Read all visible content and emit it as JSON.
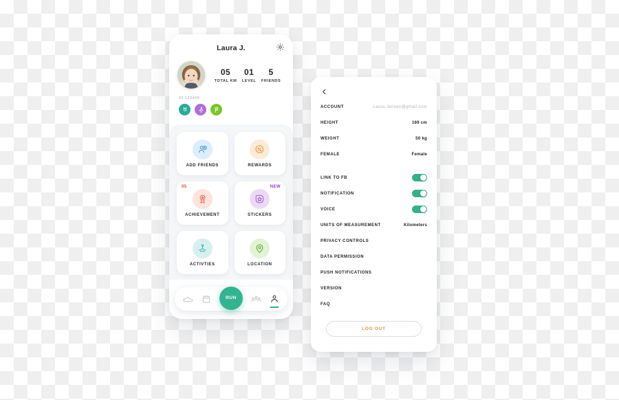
{
  "colors": {
    "green": "#34b392",
    "toggle_on": "#36b08c",
    "orange": "#f0912f",
    "red": "#e8432b",
    "purple": "#8b3fd4",
    "text_dark": "#1d1e24",
    "muted": "#b3b6bd",
    "grid_bg": "#f4f6f8"
  },
  "profile": {
    "name": "Laura J.",
    "settings_icon": "gear-icon",
    "avatar": "user-avatar-photo",
    "id_text": "ID 123456",
    "stats": [
      {
        "value": "05",
        "label": "TOTAL KM"
      },
      {
        "value": "01",
        "label": "LEVEL"
      },
      {
        "value": "5",
        "label": "FRIENDS"
      }
    ],
    "badges": [
      {
        "icon": "medal-badge-icon",
        "color": "#2aab9c"
      },
      {
        "icon": "running-badge-icon",
        "color": "#b06fd6"
      },
      {
        "icon": "flag-badge-icon",
        "color": "#7cc62a"
      }
    ],
    "tiles": [
      {
        "label": "ADD FRIENDS",
        "icon": "add-friend-icon",
        "icon_color": "#4a9fd8",
        "bg": "#dceefb",
        "badge": null,
        "badge_type": null
      },
      {
        "label": "REWARDS",
        "icon": "discount-icon",
        "icon_color": "#f0963a",
        "bg": "#fcebd9",
        "badge": null,
        "badge_type": null
      },
      {
        "label": "ACHIEVEMENT",
        "icon": "medal-icon",
        "icon_color": "#ef6a50",
        "bg": "#fde4dd",
        "badge": "05",
        "badge_type": "count"
      },
      {
        "label": "STICKERS",
        "icon": "sticker-star-icon",
        "icon_color": "#a05fd0",
        "bg": "#ecd9f7",
        "badge": "NEW",
        "badge_type": "tag"
      },
      {
        "label": "ACTIVTIES",
        "icon": "yoga-icon",
        "icon_color": "#36b0a8",
        "bg": "#d7f0ee",
        "badge": null,
        "badge_type": null
      },
      {
        "label": "LOCATION",
        "icon": "map-pin-icon",
        "icon_color": "#5aa832",
        "bg": "#e3f2d4",
        "badge": null,
        "badge_type": null
      }
    ],
    "nav": [
      {
        "icon": "shoe-icon",
        "active": false
      },
      {
        "icon": "calendar-icon",
        "active": false
      },
      {
        "icon": "group-icon",
        "active": false
      },
      {
        "icon": "person-icon",
        "active": true
      }
    ],
    "run_button": "RUN"
  },
  "settings": {
    "back_icon": "back-chevron-icon",
    "info_rows": [
      {
        "label": "ACCOUNT",
        "value": "Laura.Jensen@gmail.com",
        "muted": true
      },
      {
        "label": "HEIGHT",
        "value": "169 cm",
        "muted": false
      },
      {
        "label": "WEIGHT",
        "value": "50 kg",
        "muted": false
      },
      {
        "label": "FEMALE",
        "value": "Female",
        "muted": false
      }
    ],
    "toggle_rows": [
      {
        "label": "LINK TO FB",
        "on": true
      },
      {
        "label": "NOTIFICATION",
        "on": true
      },
      {
        "label": "VOICE",
        "on": true
      }
    ],
    "units_row": {
      "label": "UNITS OF MEASUREMENT",
      "value": "Kilometers"
    },
    "menu_rows": [
      {
        "label": "PRIVACY CONTROLS"
      },
      {
        "label": "DATA PERMISSION"
      },
      {
        "label": "PUSH NOTIFICATIONS"
      },
      {
        "label": "VERSION"
      },
      {
        "label": "FAQ"
      }
    ],
    "logout_label": "LOG OUT"
  }
}
